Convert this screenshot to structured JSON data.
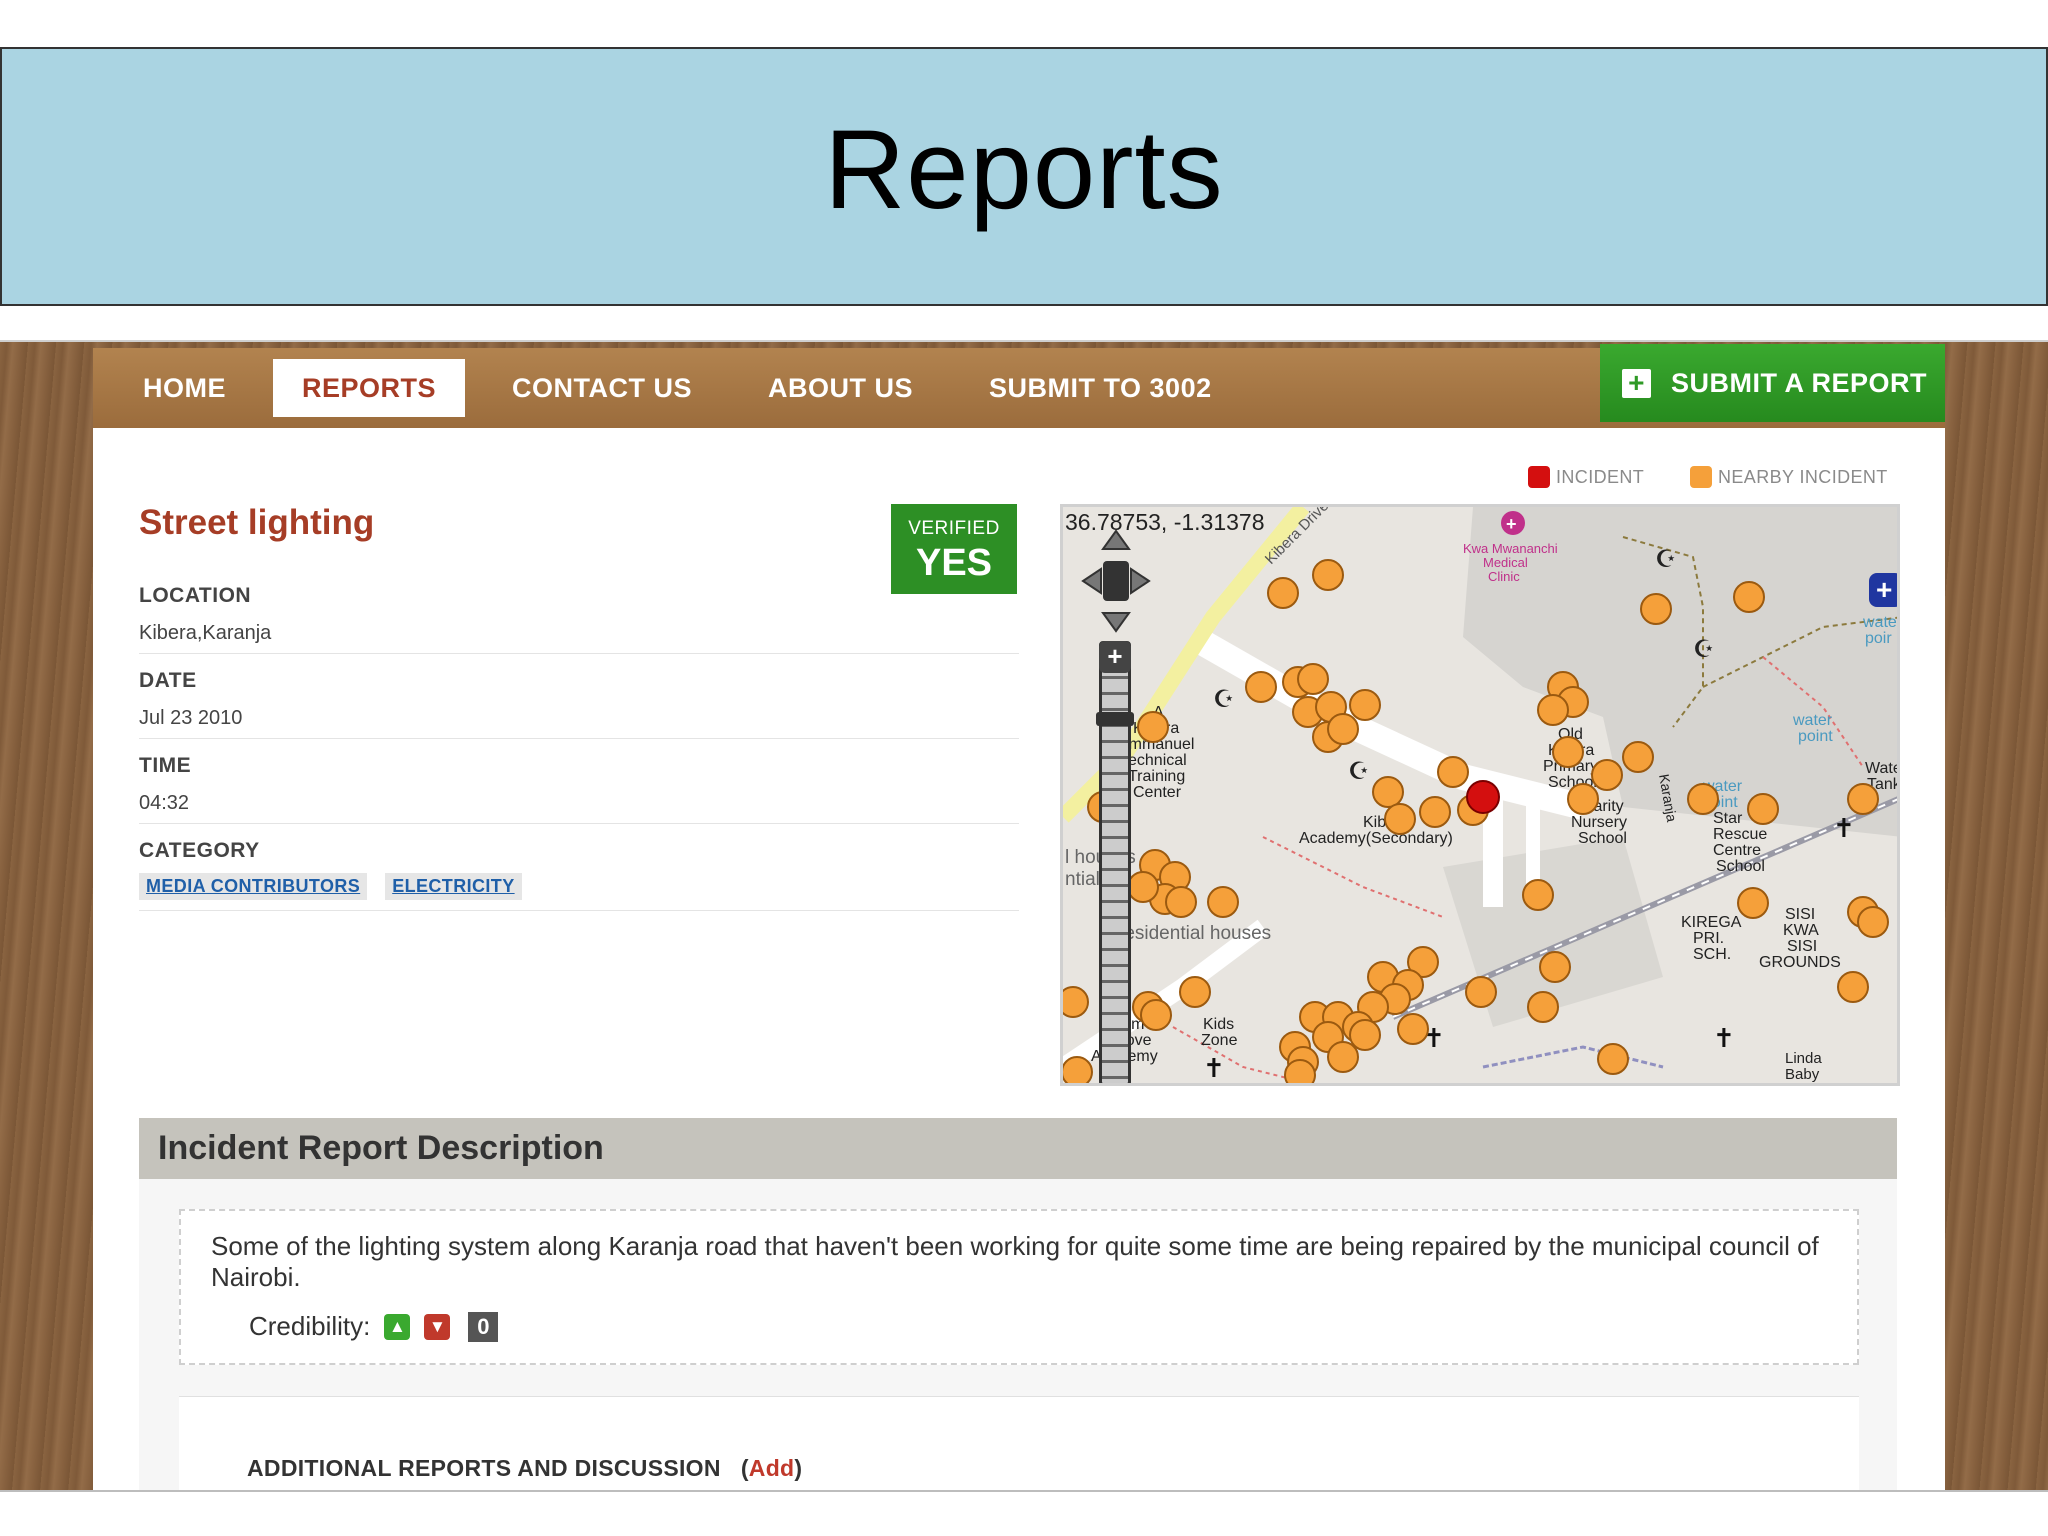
{
  "slide": {
    "title": "Reports"
  },
  "nav": {
    "items": [
      {
        "label": "HOME",
        "active": false
      },
      {
        "label": "REPORTS",
        "active": true
      },
      {
        "label": "CONTACT US",
        "active": false
      },
      {
        "label": "ABOUT US",
        "active": false
      },
      {
        "label": "SUBMIT TO 3002",
        "active": false
      }
    ],
    "submit_label": "SUBMIT A REPORT"
  },
  "report": {
    "title": "Street lighting",
    "verified_label": "VERIFIED",
    "verified_value": "YES",
    "location_label": "LOCATION",
    "location": "Kibera,Karanja",
    "date_label": "DATE",
    "date": "Jul 23 2010",
    "time_label": "TIME",
    "time": "04:32",
    "category_label": "CATEGORY",
    "categories": [
      "MEDIA CONTRIBUTORS",
      "ELECTRICITY"
    ]
  },
  "legend": {
    "incident": "INCIDENT",
    "nearby": "NEARBY INCIDENT"
  },
  "map": {
    "coords": "36.78753, -1.31378",
    "labels": {
      "kibera_drive": "Kibera Drive",
      "clinic": "Kwa Mwananchi Medical Clinic",
      "emmanuel": "A Kibera Emmanuel Technical Training Center",
      "old_primary": "Old Kibera Primary School",
      "charity": "Charity Nursery School",
      "academy": "Kibera Academy(Secondary)",
      "star_rescue": "Star Rescue Centre School",
      "water_point": "water point",
      "water_tank": "Water Tank",
      "kirega": "KIREGA PRI. SCH.",
      "sisi": "SISI KWA SISI GROUNDS",
      "residential": "residential houses",
      "kids_zone": "Kids Zone",
      "palm": "Palm Grove Academy",
      "linda": "Linda Baby",
      "karanja": "Karanja",
      "houses": "l houses ntial"
    }
  },
  "description": {
    "heading": "Incident Report Description",
    "text": "Some of the lighting system along Karanja road that haven't been working for quite some time are being repaired by the municipal council of Nairobi.",
    "credibility_label": "Credibility:",
    "credibility_count": "0",
    "additional_label": "ADDITIONAL REPORTS AND DISCUSSION",
    "add_link": "Add"
  },
  "colors": {
    "incident": "#d40f0f",
    "nearby": "#f5a03a",
    "nav": "#a87948",
    "submit": "#2f9a26",
    "title": "#a63d26",
    "banner": "#aad4e2"
  }
}
